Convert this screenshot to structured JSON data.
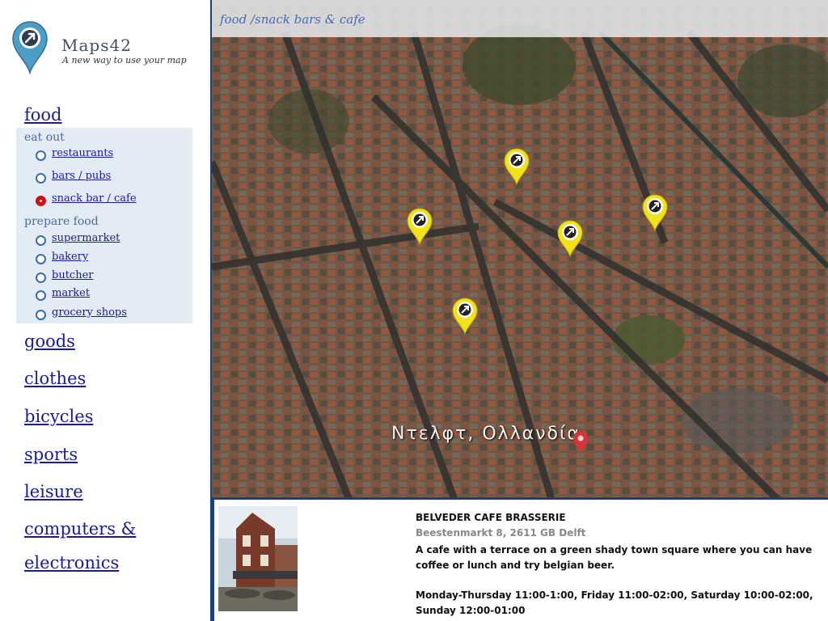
{
  "brand": {
    "name": "Maps42",
    "tagline": "A new way to use your map"
  },
  "colors": {
    "accent": "#1f3f7a",
    "link": "#1a1a9a",
    "panel_bg": "#e3ebf5",
    "pin": "#f2e21a",
    "selected": "#cc1111"
  },
  "sidebar": {
    "active_category": "food",
    "food_groups": [
      {
        "label": "eat out",
        "items": [
          {
            "label": "restaurants",
            "checked": false
          },
          {
            "label": "bars / pubs",
            "checked": false
          },
          {
            "label": "snack bar / cafe",
            "checked": true
          }
        ]
      },
      {
        "label": "prepare food",
        "items": [
          {
            "label": "supermarket",
            "checked": false
          },
          {
            "label": "bakery",
            "checked": false
          },
          {
            "label": "butcher",
            "checked": false
          },
          {
            "label": "market",
            "checked": false
          },
          {
            "label": "grocery shops",
            "checked": false
          }
        ]
      }
    ],
    "categories": [
      "goods",
      "clothes",
      "bicycles",
      "sports",
      "leisure",
      "computers &",
      "electronics"
    ]
  },
  "map": {
    "title": "food /snack bars & cafe",
    "caption": "Ντελφτ, Ολλανδία",
    "pin_icon": "arrow-pin-icon",
    "pin_count": 5
  },
  "info": {
    "name": "BELVEDER CAFE BRASSERIE",
    "address": "Beestenmarkt 8, 2611 GB Delft",
    "description": "A cafe with a terrace on a green shady town square where you can have coffee or lunch and try belgian beer.",
    "hours": "Monday-Thursday 11:00-1:00, Friday 11:00-02:00, Saturday 10:00-02:00, Sunday 12:00-01:00"
  }
}
